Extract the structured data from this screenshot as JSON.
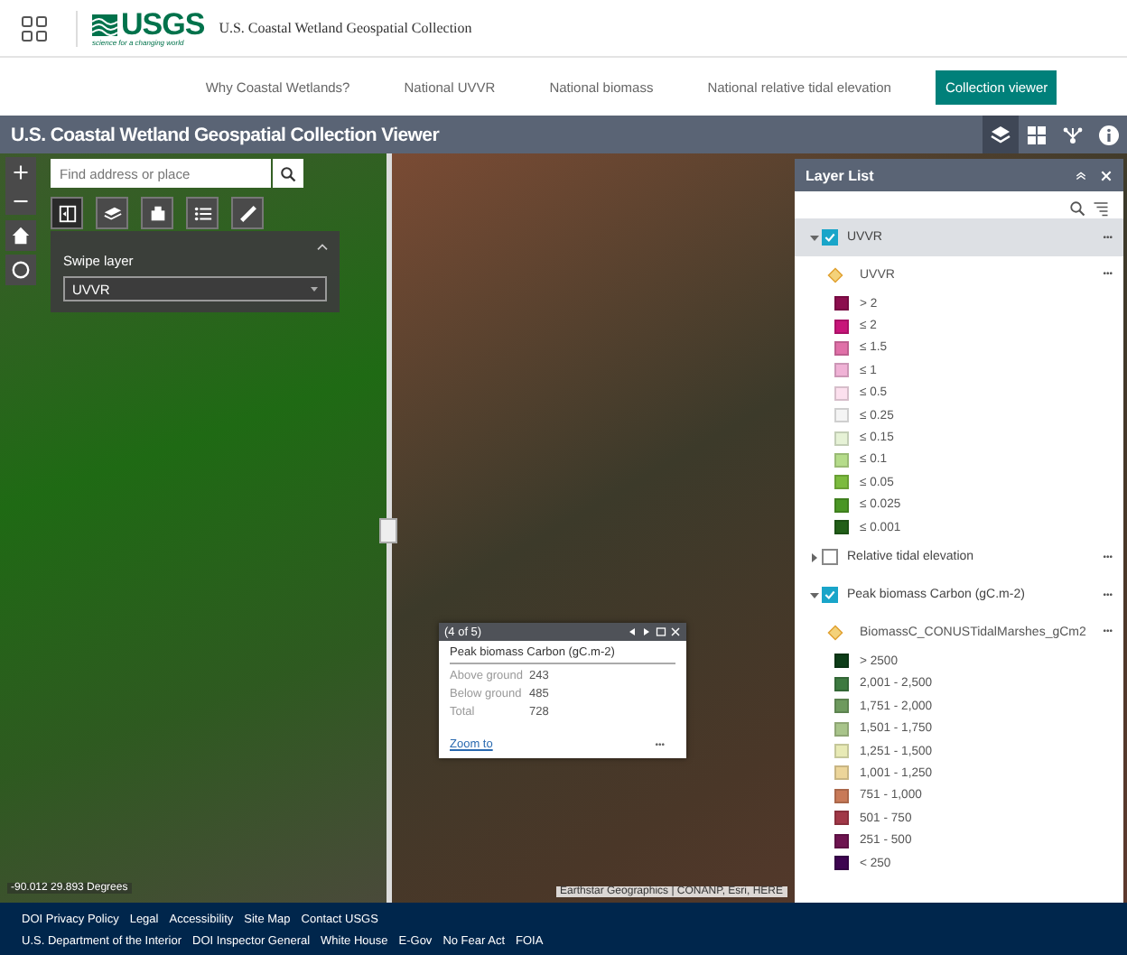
{
  "header": {
    "logo": "USGS",
    "tagline": "science for a changing world",
    "site_title": "U.S. Coastal Wetland Geospatial Collection"
  },
  "nav": [
    {
      "label": "Why Coastal Wetlands?",
      "selected": false
    },
    {
      "label": "National UVVR",
      "selected": false
    },
    {
      "label": "National biomass",
      "selected": false
    },
    {
      "label": "National relative tidal elevation",
      "selected": false
    },
    {
      "label": "Collection viewer",
      "selected": true
    }
  ],
  "app": {
    "title": "U.S. Coastal Wetland Geospatial Collection Viewer",
    "tools": [
      {
        "kind": "layers",
        "selected": true
      },
      {
        "kind": "grid",
        "selected": false
      },
      {
        "kind": "share",
        "selected": false
      },
      {
        "kind": "info",
        "selected": false
      }
    ]
  },
  "map": {
    "search": {
      "placeholder": "Find address or place"
    },
    "tools": [
      {
        "kind": "swipe",
        "selected": true
      },
      {
        "kind": "basemap",
        "selected": false
      },
      {
        "kind": "print",
        "selected": false
      },
      {
        "kind": "list",
        "selected": false
      },
      {
        "kind": "measure",
        "selected": false
      }
    ],
    "swipe_panel": {
      "title": "Swipe layer",
      "value": "UVVR"
    },
    "popup": {
      "counter": "(4 of 5)",
      "title": "Peak biomass Carbon (gC.m-2)",
      "rows": [
        {
          "label": "Above ground",
          "value": "243"
        },
        {
          "label": "Below ground",
          "value": "485"
        },
        {
          "label": "Total",
          "value": "728"
        }
      ],
      "link": "Zoom to",
      "more": "•••"
    },
    "coordinates": "-90.012 29.893 Degrees",
    "attribution": "Earthstar Geographics | CONANP, Esri, HERE"
  },
  "layer_list": {
    "title": "Layer List",
    "layers": [
      {
        "name": "UVVR",
        "checked": true,
        "expanded": true,
        "selected": true,
        "more": "•••",
        "sublayer": {
          "name": "UVVR",
          "more": "•••"
        },
        "legend": [
          {
            "label": "> 2",
            "color": "#8c0e4e"
          },
          {
            "label": "≤ 2",
            "color": "#c8157a"
          },
          {
            "label": "≤ 1.5",
            "color": "#e070a8"
          },
          {
            "label": "≤ 1",
            "color": "#f0b2d6"
          },
          {
            "label": "≤ 0.5",
            "color": "#fce0ee"
          },
          {
            "label": "≤ 0.25",
            "color": "#f4f4f4"
          },
          {
            "label": "≤ 0.15",
            "color": "#e6f2d6"
          },
          {
            "label": "≤ 0.1",
            "color": "#b5dc8a"
          },
          {
            "label": "≤ 0.05",
            "color": "#7cbb3e"
          },
          {
            "label": "≤ 0.025",
            "color": "#4a9624"
          },
          {
            "label": "≤ 0.001",
            "color": "#225f18"
          }
        ]
      },
      {
        "name": "Relative tidal elevation",
        "checked": false,
        "expanded": false,
        "selected": false,
        "more": "•••"
      },
      {
        "name": "Peak biomass Carbon (gC.m-2)",
        "checked": true,
        "expanded": true,
        "selected": false,
        "more": "•••",
        "sublayer": {
          "name": "BiomassC_CONUSTidalMarshes_gCm2",
          "more": "•••"
        },
        "legend": [
          {
            "label": "> 2500",
            "color": "#0d3d18"
          },
          {
            "label": "2,001 - 2,500",
            "color": "#3d7a40"
          },
          {
            "label": "1,751 - 2,000",
            "color": "#6e9a5e"
          },
          {
            "label": "1,501 - 1,750",
            "color": "#a8c48a"
          },
          {
            "label": "1,251 - 1,500",
            "color": "#e8eab5"
          },
          {
            "label": "1,001 - 1,250",
            "color": "#ecd59a"
          },
          {
            "label": "751 - 1,000",
            "color": "#c87a58"
          },
          {
            "label": "501 - 750",
            "color": "#a13847"
          },
          {
            "label": "251 - 500",
            "color": "#6e1450"
          },
          {
            "label": "< 250",
            "color": "#3d0450"
          }
        ]
      }
    ]
  },
  "footer": {
    "top_links": [
      "DOI Privacy Policy",
      "Legal",
      "Accessibility",
      "Site Map",
      "Contact USGS"
    ],
    "bottom_links": [
      "U.S. Department of the Interior",
      "DOI Inspector General",
      "White House",
      "E-Gov",
      "No Fear Act",
      "FOIA"
    ]
  }
}
